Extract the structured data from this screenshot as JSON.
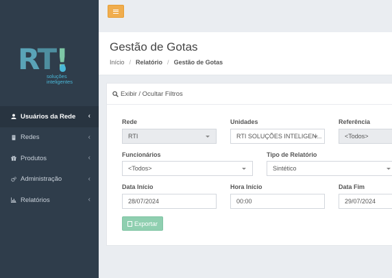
{
  "brand": {
    "logo_r": "R",
    "logo_t": "T",
    "logo_bang": "!",
    "tagline_line1": "soluções",
    "tagline_line2": "inteligentes"
  },
  "sidebar": {
    "items": [
      {
        "label": "Usuários da Rede",
        "icon": "user-icon",
        "active": true
      },
      {
        "label": "Redes",
        "icon": "building-icon",
        "active": false
      },
      {
        "label": "Produtos",
        "icon": "gift-icon",
        "active": false
      },
      {
        "label": "Administração",
        "icon": "cogs-icon",
        "active": false
      },
      {
        "label": "Relatórios",
        "icon": "bar-chart-icon",
        "active": false
      }
    ]
  },
  "header": {
    "title": "Gestão de Gotas",
    "breadcrumb": [
      "Início",
      "Relatório",
      "Gestão de Gotas"
    ]
  },
  "filters": {
    "toggle_label": "Exibir / Ocultar Filtros",
    "rede": {
      "label": "Rede",
      "value": "RTI"
    },
    "unidades": {
      "label": "Unidades",
      "value": "RTI SOLUÇÕES INTELIGEN..."
    },
    "referencia": {
      "label": "Referência",
      "value": "<Todos>"
    },
    "funcionarios": {
      "label": "Funcionários",
      "value": "<Todos>"
    },
    "tipo_relatorio": {
      "label": "Tipo de Relatório",
      "value": "Sintético"
    },
    "data_inicio": {
      "label": "Data Início",
      "value": "28/07/2024"
    },
    "hora_inicio": {
      "label": "Hora Início",
      "value": "00:00"
    },
    "data_fim": {
      "label": "Data Fim",
      "value": "29/07/2024"
    },
    "export_label": "Exportar"
  },
  "colors": {
    "sidebar_bg": "#2f3d4b",
    "toggle_btn": "#f0ad4e",
    "export_btn": "#8fcfb0"
  }
}
